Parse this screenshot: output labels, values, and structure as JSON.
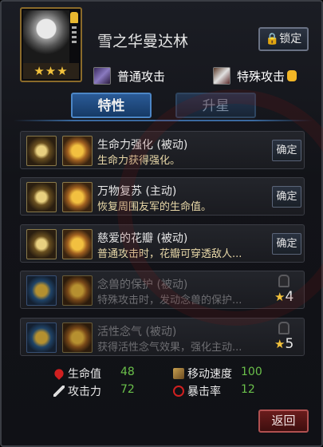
{
  "hero": {
    "name": "雪之华曼达林",
    "stars": "★★★"
  },
  "header": {
    "lock_label": "🔒锁定"
  },
  "attacks": {
    "normal_label": "普通攻击",
    "special_label": "特殊攻击"
  },
  "tabs": [
    {
      "label": "特性",
      "active": true
    },
    {
      "label": "升星",
      "active": false
    }
  ],
  "skills": [
    {
      "title": "生命力强化 (被动)",
      "desc": "生命力获得强化。",
      "action": "确定",
      "locked": false
    },
    {
      "title": "万物复苏 (主动)",
      "desc": "恢复周围友军的生命值。",
      "action": "确定",
      "locked": false
    },
    {
      "title": "慈爱的花瓣 (被动)",
      "desc": "普通攻击时，花瓣可穿透敌人...",
      "action": "确定",
      "locked": false
    },
    {
      "title": "念兽的保护 (被动)",
      "desc": "特殊攻击时，发动念兽的保护...",
      "star_req": "4",
      "locked": true
    },
    {
      "title": "活性念气 (被动)",
      "desc": "获得活性念气效果，强化主动...",
      "star_req": "5",
      "locked": true
    }
  ],
  "stats": {
    "hp": {
      "label": "生命值",
      "value": "48"
    },
    "atk": {
      "label": "攻击力",
      "value": "72"
    },
    "speed": {
      "label": "移动速度",
      "value": "100"
    },
    "crit": {
      "label": "暴击率",
      "value": "12"
    }
  },
  "footer": {
    "back_label": "返回"
  },
  "colors": {
    "stat_value": "#6ac04a",
    "desc_active": "#e8d8a8",
    "tab_active": "#2a5a96",
    "back_button": "#6a1c1c"
  }
}
